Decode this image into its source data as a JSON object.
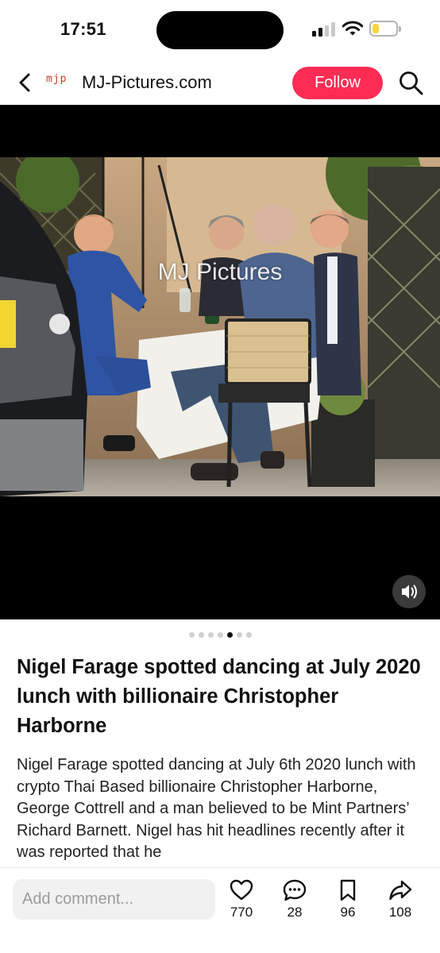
{
  "status_bar": {
    "time": "17:51",
    "battery_level": 0.3
  },
  "header": {
    "logo_text": "mjp",
    "site_name": "MJ-Pictures.com",
    "follow_label": "Follow"
  },
  "media": {
    "watermark": "MJ Pictures",
    "carousel": {
      "total": 7,
      "active_index": 4
    }
  },
  "post": {
    "title": "Nigel Farage spotted dancing at July 2020 lunch with billionaire Christopher Harborne",
    "description": "Nigel Farage spotted dancing at July 6th 2020 lunch with crypto Thai Based billionaire Christopher Harborne, George Cottrell and a man believed to be Mint Partners’ Richard Barnett. Nigel has hit headlines recently after it was reported that he"
  },
  "bottom_bar": {
    "comment_placeholder": "Add comment...",
    "likes": "770",
    "comments": "28",
    "saves": "96",
    "shares": "108"
  },
  "colors": {
    "follow": "#fe2c55",
    "battery": "#f5d442"
  }
}
